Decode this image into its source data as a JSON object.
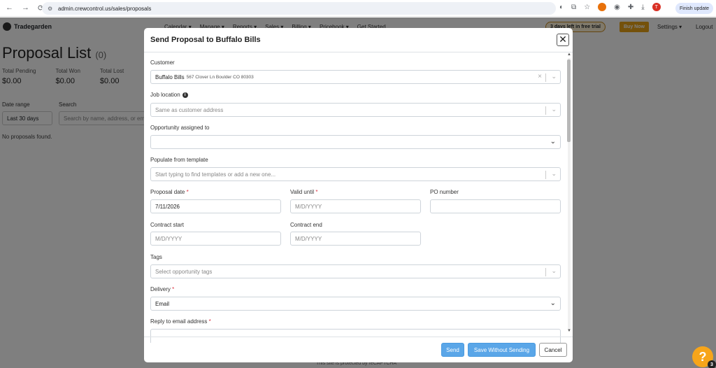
{
  "browser": {
    "url": "admin.crewcontrol.us/sales/proposals",
    "finish_update": "Finish update"
  },
  "app": {
    "brand": "Tradegarden",
    "menus": [
      "Calendar ▾",
      "Manage ▾",
      "Reports ▾",
      "Sales ▾",
      "Billing ▾",
      "Pricebook ▾",
      "Get Started"
    ],
    "trial": "3 days left in free trial",
    "buy_now": "Buy Now",
    "settings": "Settings ▾",
    "logout": "Logout",
    "page_title": "Proposal List",
    "page_count": "(0)",
    "stats": [
      {
        "label": "Total Pending",
        "value": "$0.00"
      },
      {
        "label": "Total Won",
        "value": "$0.00"
      },
      {
        "label": "Total Lost",
        "value": "$0.00"
      }
    ],
    "date_range_label": "Date range",
    "date_range_value": "Last 30 days",
    "search_label": "Search",
    "search_placeholder": "Search by name, address, or em",
    "no_proposals": "No proposals found.",
    "footnote": "This site is protected by reCAPTCHA"
  },
  "modal": {
    "title": "Send Proposal to Buffalo Bills",
    "close": "✕",
    "customer_label": "Customer",
    "customer_name": "Buffalo Bills",
    "customer_address": "567 Clover Ln Boulder CO 80303",
    "job_location_label": "Job location",
    "job_location_placeholder": "Same as customer address",
    "opportunity_label": "Opportunity assigned to",
    "opportunity_value": "",
    "template_label": "Populate from template",
    "template_placeholder": "Start typing to find templates or add a new one...",
    "proposal_date_label": "Proposal date",
    "proposal_date_value": "7/11/2026",
    "valid_until_label": "Valid until",
    "valid_until_placeholder": "M/D/YYYY",
    "po_number_label": "PO number",
    "contract_start_label": "Contract start",
    "contract_start_placeholder": "M/D/YYYY",
    "contract_end_label": "Contract end",
    "contract_end_placeholder": "M/D/YYYY",
    "tags_label": "Tags",
    "tags_placeholder": "Select opportunity tags",
    "delivery_label": "Delivery",
    "delivery_value": "Email",
    "reply_label": "Reply to email address",
    "send_button": "Send",
    "save_without_sending_button": "Save Without Sending",
    "cancel_button": "Cancel",
    "required_mark": "*"
  },
  "help_badge": "3"
}
